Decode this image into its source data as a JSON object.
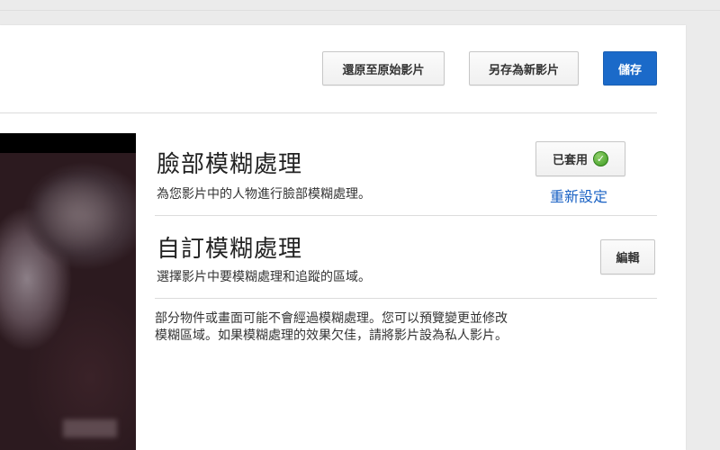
{
  "toolbar": {
    "revert_label": "還原至原始影片",
    "save_as_label": "另存為新影片",
    "save_label": "儲存"
  },
  "face_blur": {
    "title": "臉部模糊處理",
    "description": "為您影片中的人物進行臉部模糊處理。",
    "applied_label": "已套用",
    "reset_label": "重新設定"
  },
  "custom_blur": {
    "title": "自訂模糊處理",
    "description": "選擇影片中要模糊處理和追蹤的區域。",
    "edit_label": "編輯"
  },
  "note": "部分物件或畫面可能不會經過模糊處理。您可以預覽變更並修改模糊區域。如果模糊處理的效果欠佳，請將影片設為私人影片。",
  "colors": {
    "primary": "#1b6ac9",
    "link": "#1a62c4",
    "check": "#3e9b23",
    "page_bg": "#ebebeb"
  },
  "icons": {
    "applied": "check-circle-icon"
  }
}
